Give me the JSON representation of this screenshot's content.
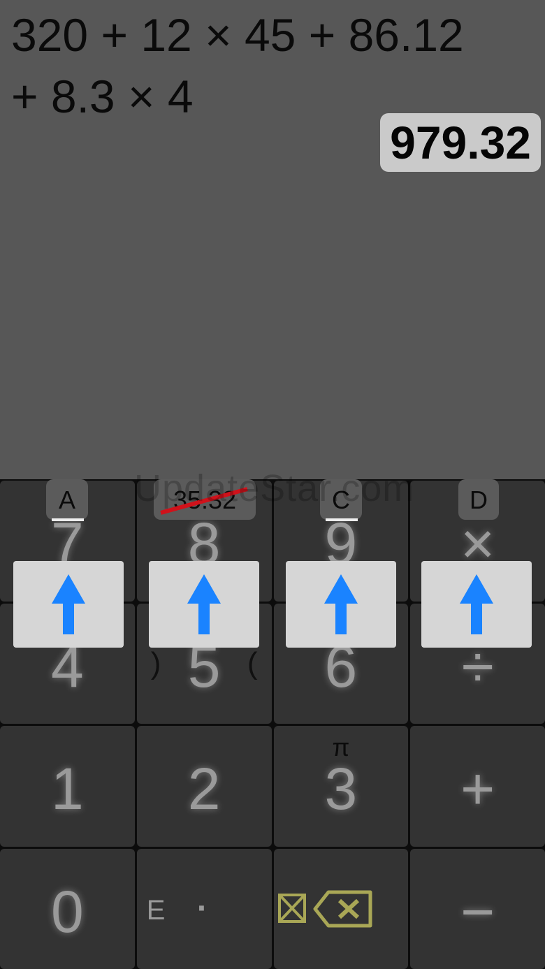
{
  "display": {
    "expression": "320 + 12 × 45 + 86.12\n+ 8.3 × 4",
    "result": "979.32"
  },
  "memory": {
    "a_label": "A",
    "b_value": "35.32",
    "c_label": "C",
    "d_label": "D"
  },
  "watermark": "UpdateStar.com",
  "keys": {
    "seven": "7",
    "eight": "8",
    "nine": "9",
    "multiply": "×",
    "four": "4",
    "five": "5",
    "paren_close": ")",
    "paren_open": "(",
    "six": "6",
    "divide": "÷",
    "one": "1",
    "two": "2",
    "three": "3",
    "pi": "π",
    "plus": "+",
    "zero": "0",
    "exponent": "E",
    "decimal": "·",
    "minus": "−"
  },
  "icons": {
    "clear": "clear-all-icon",
    "backspace": "backspace-icon",
    "store_arrow": "up-arrow-icon"
  },
  "colors": {
    "background": "#575757",
    "result_bg": "#cacaca",
    "key_bg": "#333333",
    "arrow_blue": "#1a83ff",
    "delete_accent": "#a9a756",
    "strike_red": "#d0121b"
  }
}
